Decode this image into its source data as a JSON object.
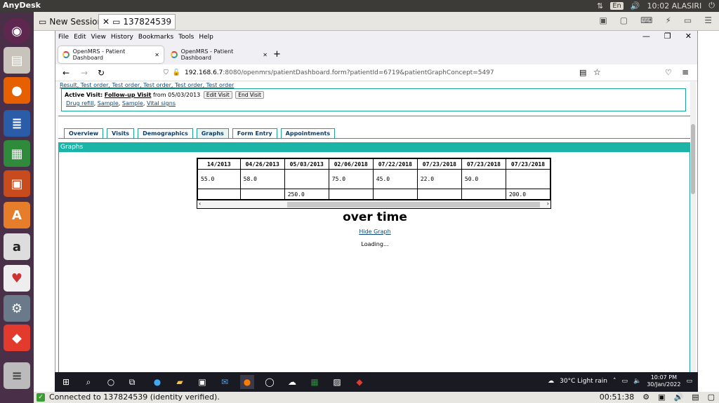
{
  "ubuntu_bar": {
    "app_name": "AnyDesk",
    "lang": "En",
    "clock_user": "10:02 ALASIRI"
  },
  "anydesk": {
    "tabs": [
      {
        "label": "New Session"
      },
      {
        "label": "137824539"
      }
    ],
    "status": "Connected to 137824539 (identity verified).",
    "timer": "00:51:38"
  },
  "firefox": {
    "menu": [
      "File",
      "Edit",
      "View",
      "History",
      "Bookmarks",
      "Tools",
      "Help"
    ],
    "tabs": [
      {
        "label": "OpenMRS - Patient Dashboard"
      },
      {
        "label": "OpenMRS - Patient Dashboard"
      }
    ],
    "url_host": "192.168.6.7",
    "url_rest": ":8080/openmrs/patientDashboard.form?patientId=6719&patientGraphConcept=5497"
  },
  "page": {
    "obs_links": "Result,  Test order,  Test order,  Test order,  Test order,  Test order",
    "visit": {
      "label": "Active Visit:",
      "type": "Follow-up Visit",
      "from": "from 05/03/2013",
      "edit_btn": "Edit Visit",
      "end_btn": "End Visit",
      "links": [
        "Drug refill",
        "Sample",
        "Sample",
        "Vital signs"
      ]
    },
    "tabs": [
      "Overview",
      "Visits",
      "Demographics",
      "Graphs",
      "Form Entry",
      "Appointments"
    ],
    "active_tab": "Graphs",
    "section_header": "Graphs",
    "table": {
      "headers": [
        "14/2013",
        "04/26/2013",
        "05/03/2013",
        "02/06/2018",
        "07/22/2018",
        "07/23/2018",
        "07/23/2018",
        "07/23/2018"
      ],
      "row1": [
        "55.0",
        "58.0",
        "",
        "75.0",
        "45.0",
        "22.0",
        "50.0",
        ""
      ],
      "row2": [
        "",
        "",
        "250.0",
        "",
        "",
        "",
        "",
        "200.0"
      ]
    },
    "chart_title": "over time",
    "hide_graph": "Hide Graph",
    "loading": "Loading..."
  },
  "windows": {
    "weather": "30°C  Light rain",
    "time": "10:07 PM",
    "date": "30/Jan/2022"
  }
}
